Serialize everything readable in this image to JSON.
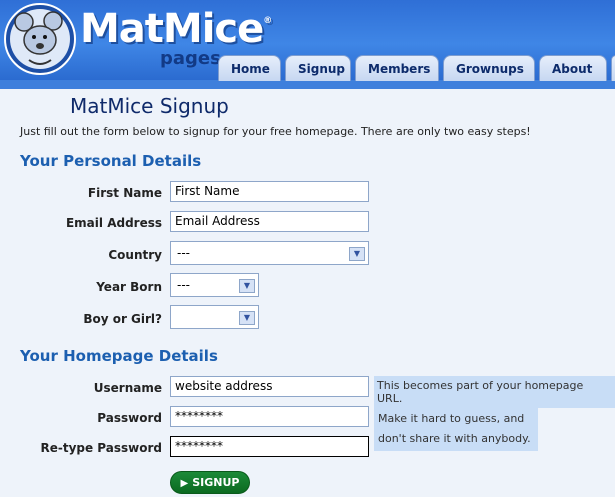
{
  "header": {
    "brand": "MatMice",
    "brand_mark": "®",
    "subbrand": "pages",
    "tabs": [
      {
        "label": "Home"
      },
      {
        "label": "Signup"
      },
      {
        "label": "Members"
      },
      {
        "label": "Grownups"
      },
      {
        "label": "About"
      }
    ]
  },
  "page": {
    "title": "MatMice Signup",
    "intro": "Just fill out the form below to signup for your free homepage. There are only two easy steps!"
  },
  "personal": {
    "heading": "Your Personal Details",
    "first_name": {
      "label": "First Name",
      "value": "First Name"
    },
    "email": {
      "label": "Email Address",
      "value": "Email Address"
    },
    "country": {
      "label": "Country",
      "value": "---"
    },
    "year_born": {
      "label": "Year Born",
      "value": "---"
    },
    "gender": {
      "label": "Boy or Girl?",
      "value": ""
    }
  },
  "homepage": {
    "heading": "Your Homepage Details",
    "username": {
      "label": "Username",
      "value": "website address",
      "hint": "This becomes part of your homepage URL."
    },
    "password": {
      "label": "Password",
      "value": "********"
    },
    "retype": {
      "label": "Re-type Password",
      "value": "********"
    },
    "password_hint_1": "Make it hard to guess, and",
    "password_hint_2": "don't share it with anybody."
  },
  "actions": {
    "signup_label": "SIGNUP"
  },
  "colors": {
    "header": "#3f86e6",
    "accent": "#1c5fb0",
    "button": "#0b6a20",
    "hint_bg": "#c8ddf6"
  }
}
